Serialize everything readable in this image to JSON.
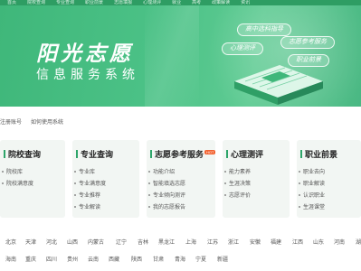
{
  "topnav": [
    "首页",
    "院校查询",
    "专业查询",
    "职业前景",
    "志愿填报",
    "心理测评",
    "就业",
    "高考",
    "政策解读",
    "资讯"
  ],
  "banner": {
    "title": "阳光志愿",
    "subtitle": "信息服务系统",
    "tags": [
      "高中选科指导",
      "心理测评",
      "志愿参考服务",
      "职业前景"
    ]
  },
  "account": {
    "register": "注册账号",
    "howto": "如何使用系统"
  },
  "cards": [
    {
      "title": "院校查询",
      "items": [
        "院校库",
        "院校满意度"
      ]
    },
    {
      "title": "专业查询",
      "items": [
        "专业库",
        "专业满意度",
        "专业推荐",
        "专业解读"
      ]
    },
    {
      "title": "志愿参考服务",
      "badge": "HOT",
      "items": [
        "功能介绍",
        "智能填选志愿",
        "专业倾向测评",
        "我的志愿报告"
      ]
    },
    {
      "title": "心理测评",
      "items": [
        "能力素养",
        "生涯决策",
        "志愿评价"
      ]
    },
    {
      "title": "职业前景",
      "items": [
        "职业去向",
        "职业解读",
        "认识职业",
        "生涯课堂"
      ]
    }
  ],
  "provinces": {
    "row1": [
      "北京",
      "天津",
      "河北",
      "山西",
      "内蒙古",
      "辽宁",
      "吉林",
      "黑龙江",
      "上海",
      "江苏",
      "浙江",
      "安徽",
      "福建",
      "江西",
      "山东",
      "河南",
      "湖"
    ],
    "row2": [
      "海南",
      "重庆",
      "四川",
      "贵州",
      "云南",
      "西藏",
      "陕西",
      "甘肃",
      "青海",
      "宁夏",
      "新疆"
    ]
  },
  "colors": {
    "brand": "#4cc287",
    "accent": "#2ea56a",
    "hot": "#f2612f"
  }
}
